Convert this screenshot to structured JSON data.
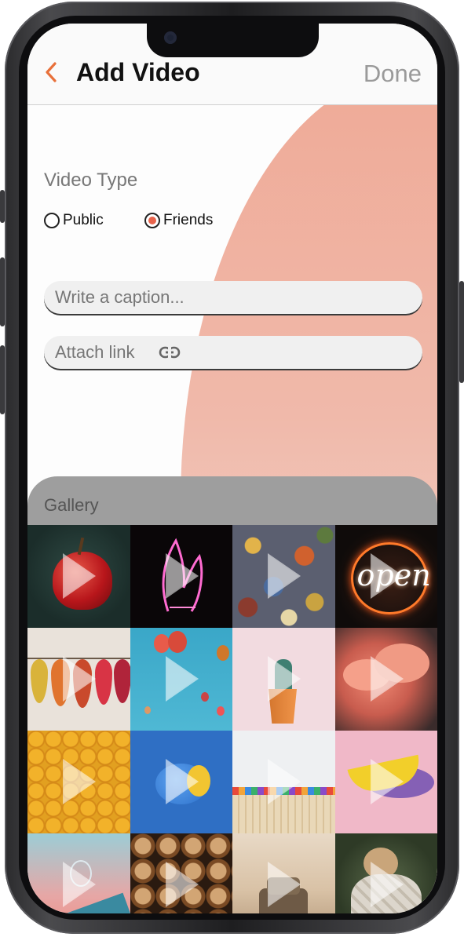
{
  "header": {
    "title": "Add Video",
    "done_label": "Done",
    "back_icon": "chevron-left-icon",
    "accent": "#e8703a"
  },
  "video_type": {
    "label": "Video Type",
    "options": [
      {
        "label": "Public",
        "selected": false
      },
      {
        "label": "Friends",
        "selected": true
      }
    ],
    "selected_color": "#e8644c"
  },
  "caption": {
    "placeholder": "Write a caption...",
    "value": ""
  },
  "link": {
    "placeholder": "Attach link",
    "icon": "link-icon"
  },
  "gallery": {
    "label": "Gallery",
    "thumbnails": [
      {
        "subject": "red apple"
      },
      {
        "subject": "neon praying hands"
      },
      {
        "subject": "jigsaw puzzle pieces"
      },
      {
        "subject": "open neon sign"
      },
      {
        "subject": "autumn leaves on line"
      },
      {
        "subject": "hot air balloons"
      },
      {
        "subject": "potted cactus"
      },
      {
        "subject": "pink clouds"
      },
      {
        "subject": "yellow emoji balls"
      },
      {
        "subject": "blue lemon"
      },
      {
        "subject": "colored pencils"
      },
      {
        "subject": "banana on pink"
      },
      {
        "subject": "lightbulb in hand"
      },
      {
        "subject": "stacked logs"
      },
      {
        "subject": "armchair on beach"
      },
      {
        "subject": "pug in blanket"
      }
    ]
  }
}
